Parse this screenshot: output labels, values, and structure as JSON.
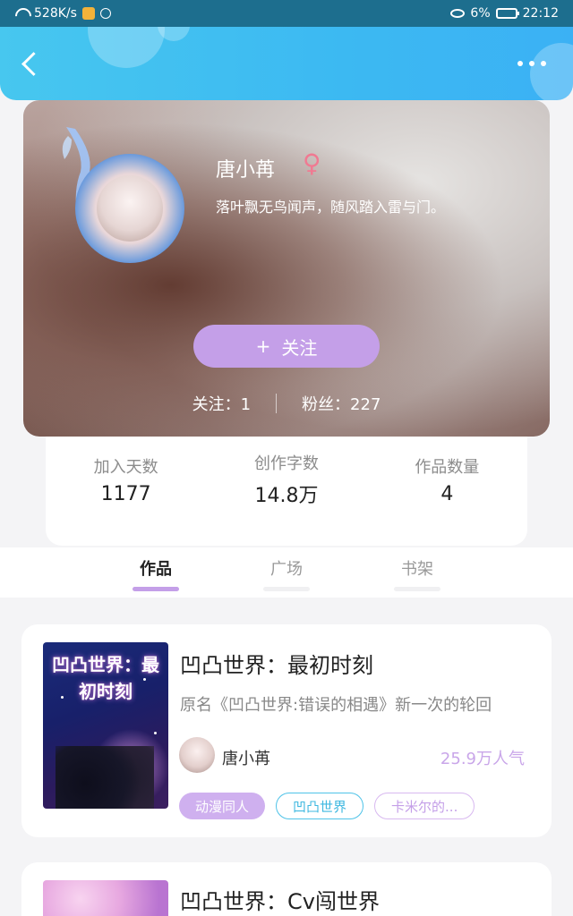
{
  "status_bar": {
    "speed": "528K/s",
    "battery": "6%",
    "time": "22:12"
  },
  "profile": {
    "name": "唐小苒",
    "gender_symbol": "♀",
    "motto": "落叶飘无鸟闻声，随风踏入雷与门。",
    "follow_button": "关注",
    "follow_plus": "+",
    "following_label": "关注：",
    "following_count": "1",
    "fans_label": "粉丝：",
    "fans_count": "227"
  },
  "stats": [
    {
      "label": "加入天数",
      "value": "1177"
    },
    {
      "label": "创作字数",
      "value": "14.8万"
    },
    {
      "label": "作品数量",
      "value": "4"
    }
  ],
  "tabs": [
    {
      "label": "作品",
      "active": true
    },
    {
      "label": "广场",
      "active": false
    },
    {
      "label": "书架",
      "active": false
    }
  ],
  "books": [
    {
      "cover_text": "凹凸世界：最初时刻",
      "title": "凹凸世界：最初时刻",
      "description": "原名《凹凸世界:错误的相遇》新一次的轮回",
      "author": "唐小苒",
      "popularity": "25.9万人气",
      "tags": [
        "动漫同人",
        "凹凸世界",
        "卡米尔的..."
      ]
    },
    {
      "title": "凹凸世界：Cv闯世界"
    }
  ],
  "colors": {
    "header": "#3cb9f2",
    "accent_purple": "#c49fe8",
    "tag_blue": "#3fb8e0"
  },
  "icons": [
    "back-icon",
    "more-icon",
    "plus-icon",
    "female-icon"
  ]
}
